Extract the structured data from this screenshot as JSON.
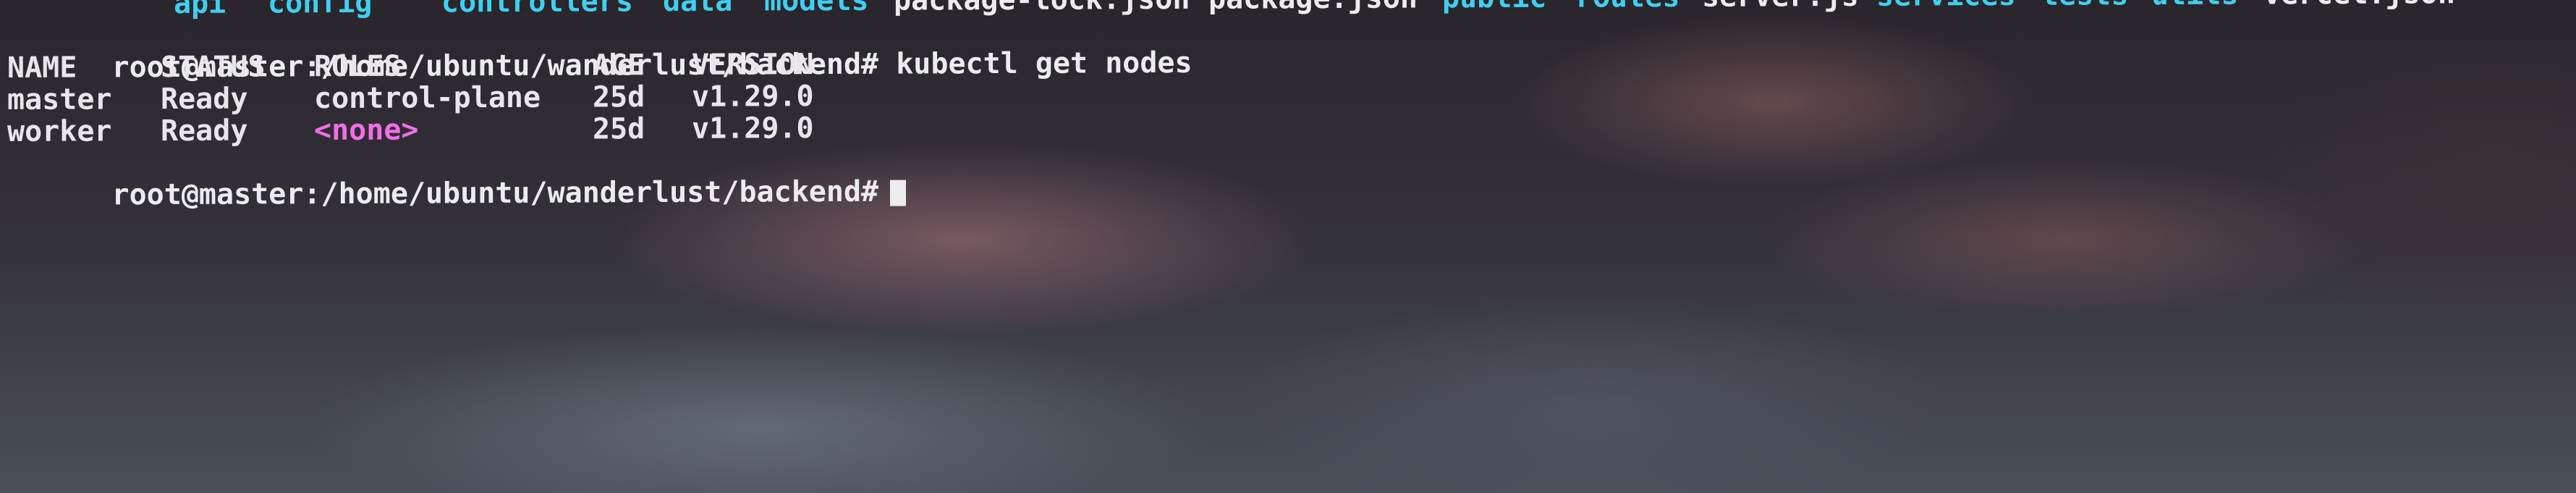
{
  "terminal": {
    "ls_items": [
      {
        "text": "api",
        "kind": "dir"
      },
      {
        "text": "config",
        "kind": "dir"
      },
      {
        "text": "controllers",
        "kind": "dir"
      },
      {
        "text": "data",
        "kind": "dir"
      },
      {
        "text": "models",
        "kind": "dir"
      },
      {
        "text": "package-lock.json",
        "kind": "file"
      },
      {
        "text": "package.json",
        "kind": "file"
      },
      {
        "text": "public",
        "kind": "dir"
      },
      {
        "text": "routes",
        "kind": "dir"
      },
      {
        "text": "server.js",
        "kind": "file"
      },
      {
        "text": "services",
        "kind": "dir"
      },
      {
        "text": "tests",
        "kind": "dir"
      },
      {
        "text": "utils",
        "kind": "dir"
      },
      {
        "text": "vercel.json",
        "kind": "file"
      }
    ],
    "command_line": {
      "prompt": "root@master:/home/ubuntu/wanderlust/backend#",
      "command": "kubectl get nodes"
    },
    "table": {
      "headers": [
        "NAME",
        "STATUS",
        "ROLES",
        "AGE",
        "VERSION"
      ],
      "rows": [
        [
          "master",
          "Ready",
          "control-plane",
          "25d",
          "v1.29.0"
        ],
        [
          "worker",
          "Ready",
          "<none>",
          "25d",
          "v1.29.0"
        ]
      ]
    },
    "current_prompt": "root@master:/home/ubuntu/wanderlust/backend#"
  },
  "colors": {
    "directory": "#3fd0f0",
    "file": "#ececec",
    "none_role": "#f06ee6",
    "text": "#e8e6e8"
  }
}
